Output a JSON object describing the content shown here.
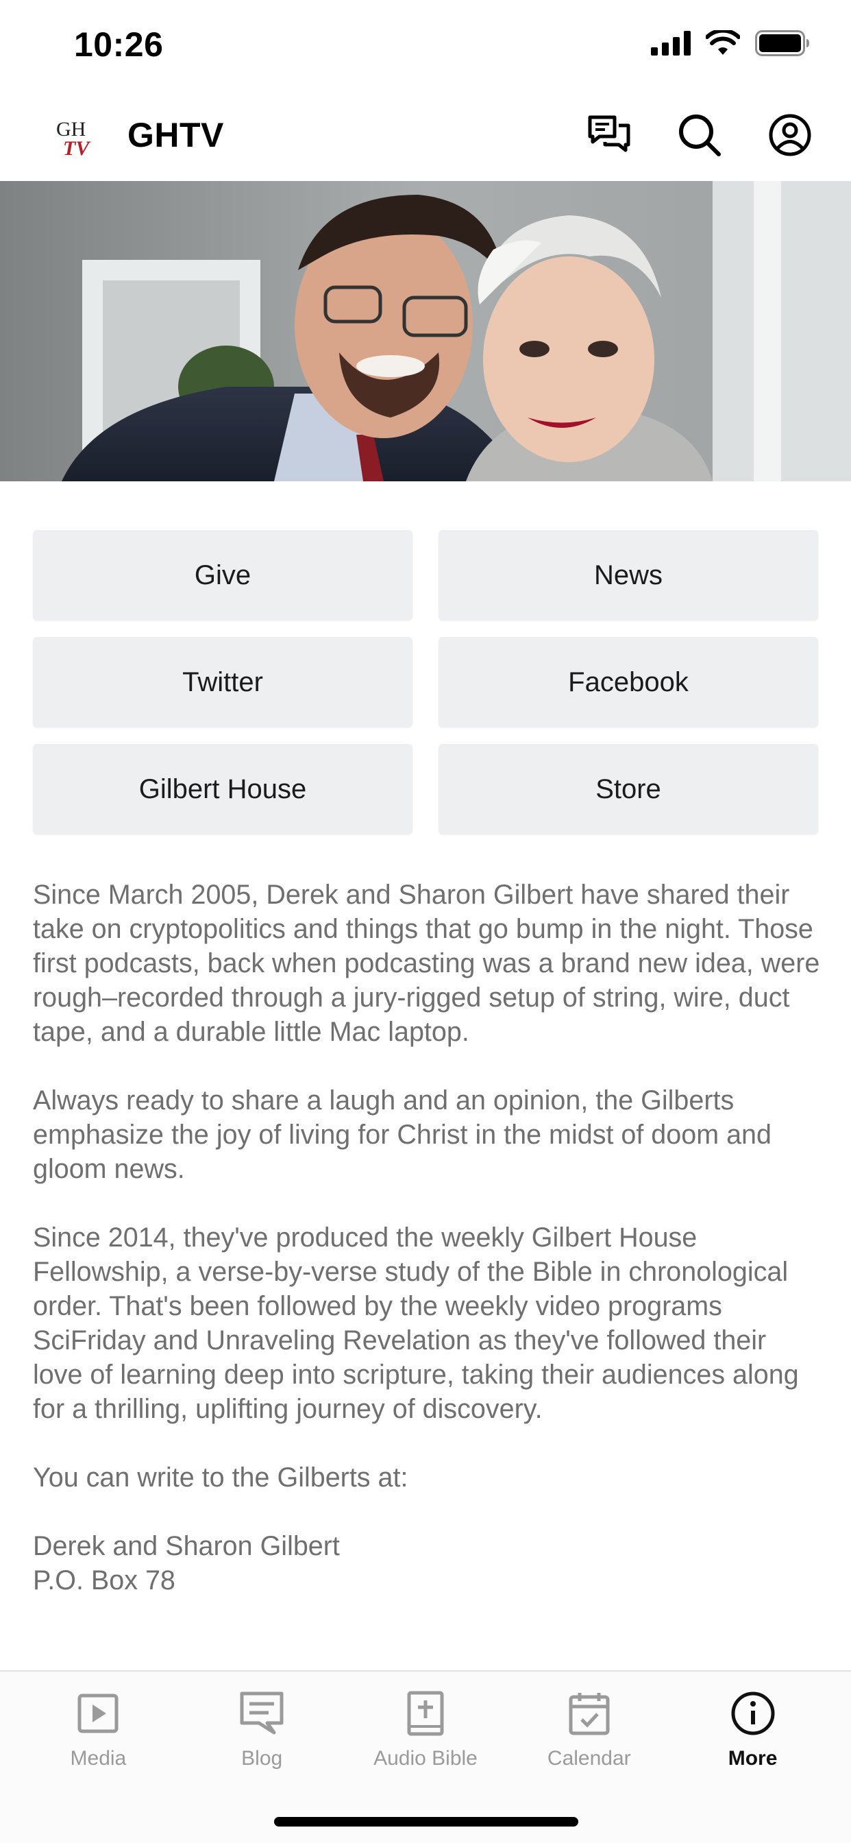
{
  "status_bar": {
    "time": "10:26"
  },
  "header": {
    "logo_text_top": "GH",
    "logo_text_bottom": "TV",
    "title": "GHTV",
    "actions": [
      {
        "icon": "chat-bubbles-icon"
      },
      {
        "icon": "search-icon"
      },
      {
        "icon": "profile-icon"
      }
    ]
  },
  "links": [
    {
      "label": "Give"
    },
    {
      "label": "News"
    },
    {
      "label": "Twitter"
    },
    {
      "label": "Facebook"
    },
    {
      "label": "Gilbert House"
    },
    {
      "label": "Store"
    }
  ],
  "description": {
    "paragraphs": [
      "Since March 2005, Derek and Sharon Gilbert have shared their take on cryptopolitics and things that go bump in the night. Those first podcasts, back when podcasting was a brand new idea, were rough–recorded through a jury-rigged setup of string, wire, duct tape, and a durable little Mac laptop.",
      "Always ready to share a laugh and an opinion, the Gilberts emphasize the joy of living for Christ in the midst of doom and gloom news.",
      "Since 2014, they've produced the weekly Gilbert House Fellowship, a verse-by-verse study of the Bible in chronological order. That's been followed by the weekly video programs SciFriday and Unraveling Revelation as they've followed their love of learning deep into scripture, taking their audiences along for a thrilling, uplifting journey of discovery.",
      "You can write to the Gilberts at:",
      "Derek and Sharon Gilbert\nP.O. Box 78"
    ]
  },
  "tab_bar": {
    "tabs": [
      {
        "label": "Media",
        "icon": "play-square-icon",
        "active": false
      },
      {
        "label": "Blog",
        "icon": "comment-lines-icon",
        "active": false
      },
      {
        "label": "Audio Bible",
        "icon": "bible-plus-icon",
        "active": false
      },
      {
        "label": "Calendar",
        "icon": "calendar-check-icon",
        "active": false
      },
      {
        "label": "More",
        "icon": "info-circle-icon",
        "active": true
      }
    ]
  },
  "colors": {
    "button_bg": "#eeeff1",
    "body_text": "#6f6f6f",
    "tab_inactive": "#9a9a9a",
    "tab_active": "#111111",
    "logo_red": "#b3202a"
  }
}
